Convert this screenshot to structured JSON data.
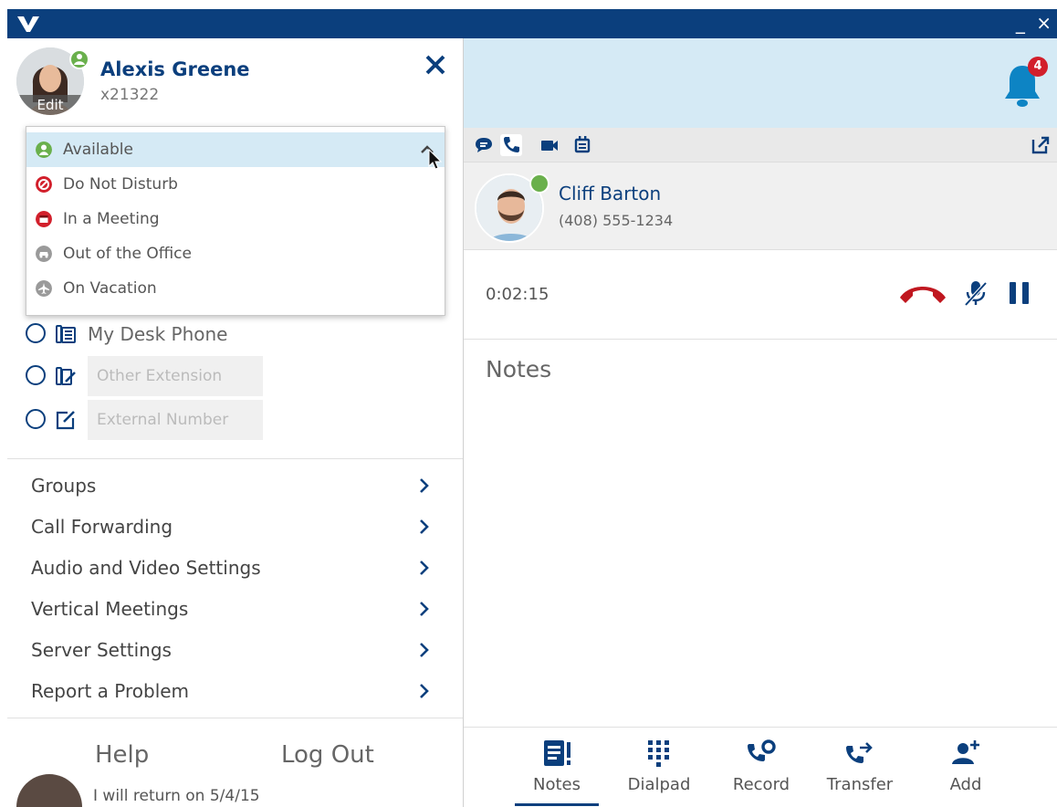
{
  "window": {
    "logo": "vertical-logo",
    "minimize_label": "_",
    "close_label": "×"
  },
  "notifications": {
    "count": "4"
  },
  "user": {
    "name": "Alexis Greene",
    "extension": "x21322",
    "edit_label": "Edit",
    "presence_color": "#6ab04c"
  },
  "presence_menu": {
    "items": [
      {
        "label": "Available",
        "icon": "person-icon",
        "color": "#6ab04c",
        "selected": true
      },
      {
        "label": "Do Not Disturb",
        "icon": "no-entry-icon",
        "color": "#d21f2b"
      },
      {
        "label": "In a Meeting",
        "icon": "calendar-icon",
        "color": "#d21f2b"
      },
      {
        "label": "Out of the Office",
        "icon": "car-icon",
        "color": "#9a9a9a"
      },
      {
        "label": "On Vacation",
        "icon": "plane-icon",
        "color": "#9a9a9a"
      }
    ]
  },
  "routing": {
    "desk_phone": "My Desk Phone",
    "other_extension_placeholder": "Other Extension",
    "external_number_placeholder": "External Number"
  },
  "menu": {
    "items": [
      {
        "label": "Groups"
      },
      {
        "label": "Call Forwarding"
      },
      {
        "label": "Audio and Video Settings"
      },
      {
        "label": "Vertical Meetings"
      },
      {
        "label": "Server Settings"
      },
      {
        "label": "Report a Problem"
      }
    ]
  },
  "footer": {
    "help": "Help",
    "logout": "Log Out"
  },
  "peek": {
    "status_text": "I will return on 5/4/15"
  },
  "contact": {
    "name": "Cliff Barton",
    "phone": "(408) 555-1234"
  },
  "call": {
    "timer": "0:02:15"
  },
  "notes": {
    "label": "Notes"
  },
  "tabs": [
    {
      "label": "Notes",
      "icon": "notes-icon",
      "active": true
    },
    {
      "label": "Dialpad",
      "icon": "dialpad-icon"
    },
    {
      "label": "Record",
      "icon": "record-icon"
    },
    {
      "label": "Transfer",
      "icon": "transfer-icon"
    },
    {
      "label": "Add",
      "icon": "add-person-icon"
    }
  ],
  "colors": {
    "brand": "#0b3f7d",
    "banner": "#d5eaf5",
    "hangup": "#c0171f",
    "available": "#6ab04c"
  }
}
